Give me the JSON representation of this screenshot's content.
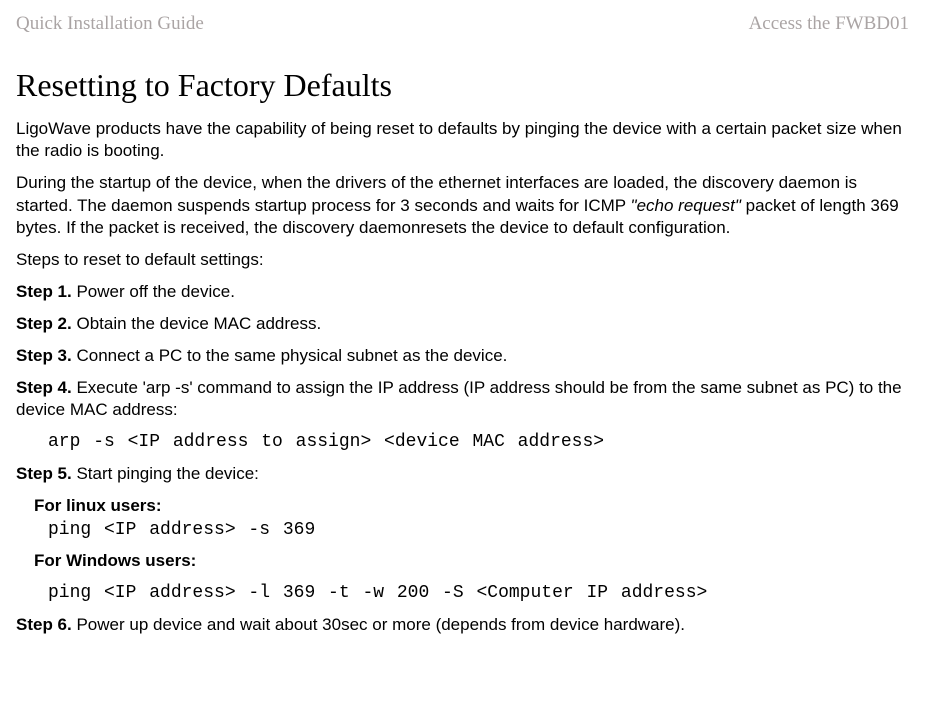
{
  "header": {
    "left": "Quick Installation Guide",
    "right": "Access the FWBD01"
  },
  "title": "Resetting to Factory Defaults",
  "intro1": "LigoWave products have the capability of being reset to defaults by pinging the device with a certain packet size when the radio is booting.",
  "intro2a": "During the startup of the device, when the drivers of the ethernet interfaces are loaded, the discovery daemon is started. The daemon suspends startup process for 3 seconds and waits for ICMP ",
  "intro2b": "\"echo request\"",
  "intro2c": " packet of length 369 bytes. If the packet is received, the discovery daemonresets the device to default configuration.",
  "stepsIntro": "Steps to reset to default settings:",
  "step1": {
    "label": "Step 1.",
    "text": " Power off the device."
  },
  "step2": {
    "label": "Step 2.",
    "text": " Obtain the device MAC address."
  },
  "step3": {
    "label": "Step 3.",
    "text": " Connect a PC to the same physical subnet as the device."
  },
  "step4": {
    "label": "Step 4.",
    "text": " Execute 'arp -s' command to assign the IP address (IP address should be from the same subnet as PC) to the device MAC address:"
  },
  "step4code": "arp -s <IP address to assign> <device MAC address>",
  "step5": {
    "label": "Step 5.",
    "text": " Start pinging the device:"
  },
  "linuxLabel": "For linux users:",
  "linuxCode": "ping <IP address> -s 369",
  "windowsLabel": "For Windows users:",
  "windowsCode": "ping <IP address> -l 369 -t -w 200 -S <Computer IP address>",
  "step6": {
    "label": "Step 6.",
    "text": " Power up device and wait about 30sec or more (depends from device hardware)."
  }
}
